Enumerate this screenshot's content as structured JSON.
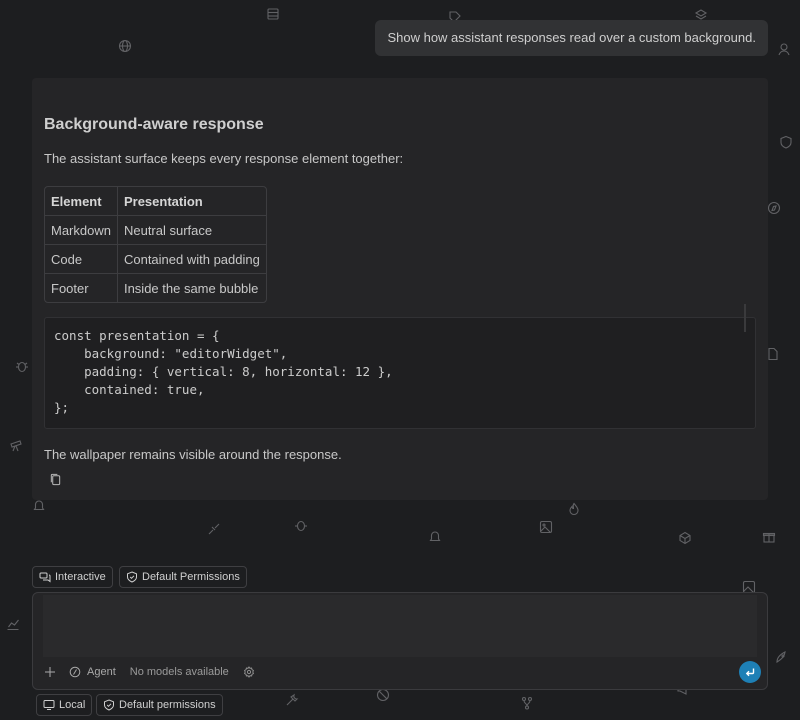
{
  "user_message": "Show how assistant responses read over a custom background.",
  "response": {
    "title": "Background-aware response",
    "intro": "The assistant surface keeps every response element together:",
    "table": {
      "headers": [
        "Element",
        "Presentation"
      ],
      "rows": [
        [
          "Markdown",
          "Neutral surface"
        ],
        [
          "Code",
          "Contained with padding"
        ],
        [
          "Footer",
          "Inside the same bubble"
        ]
      ]
    },
    "code": "const presentation = {\n    background: \"editorWidget\",\n    padding: { vertical: 8, horizontal: 12 },\n    contained: true,\n};",
    "outro": "The wallpaper remains visible around the response.",
    "copy_icon": "copy-icon"
  },
  "chips": {
    "interactive": "Interactive",
    "default_permissions": "Default Permissions"
  },
  "composer": {
    "placeholder": "",
    "value": "",
    "mode": "Agent",
    "model": "No models available"
  },
  "footer": {
    "local": "Local",
    "permissions": "Default permissions"
  },
  "colors": {
    "background": "#1d1e20",
    "surface": "#252527",
    "accent": "#1e80b6"
  }
}
